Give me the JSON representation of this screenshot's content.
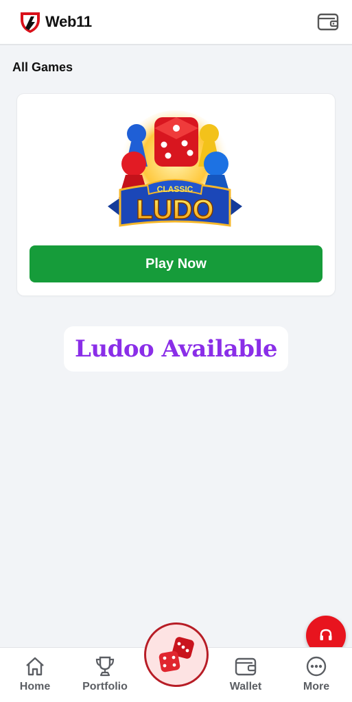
{
  "header": {
    "brand_name": "Web11",
    "brand_icon": "web11-logo-icon",
    "wallet_icon": "wallet-icon"
  },
  "section": {
    "title": "All Games"
  },
  "game_card": {
    "art_top_text": "CLASSIC",
    "art_main_text": "LUDO",
    "play_label": "Play Now"
  },
  "banner": {
    "text": "Ludoo Available"
  },
  "support": {
    "icon": "headset-icon"
  },
  "bottom_nav": {
    "items": [
      {
        "label": "Home",
        "icon": "home-icon"
      },
      {
        "label": "Portfolio",
        "icon": "trophy-icon"
      },
      {
        "label": "Wallet",
        "icon": "wallet-icon"
      },
      {
        "label": "More",
        "icon": "more-icon"
      }
    ],
    "center_icon": "dice-icon"
  },
  "colors": {
    "accent_green": "#169c3a",
    "banner_purple": "#8a2ee8",
    "support_red": "#e8141e",
    "center_border": "#b71d26"
  }
}
